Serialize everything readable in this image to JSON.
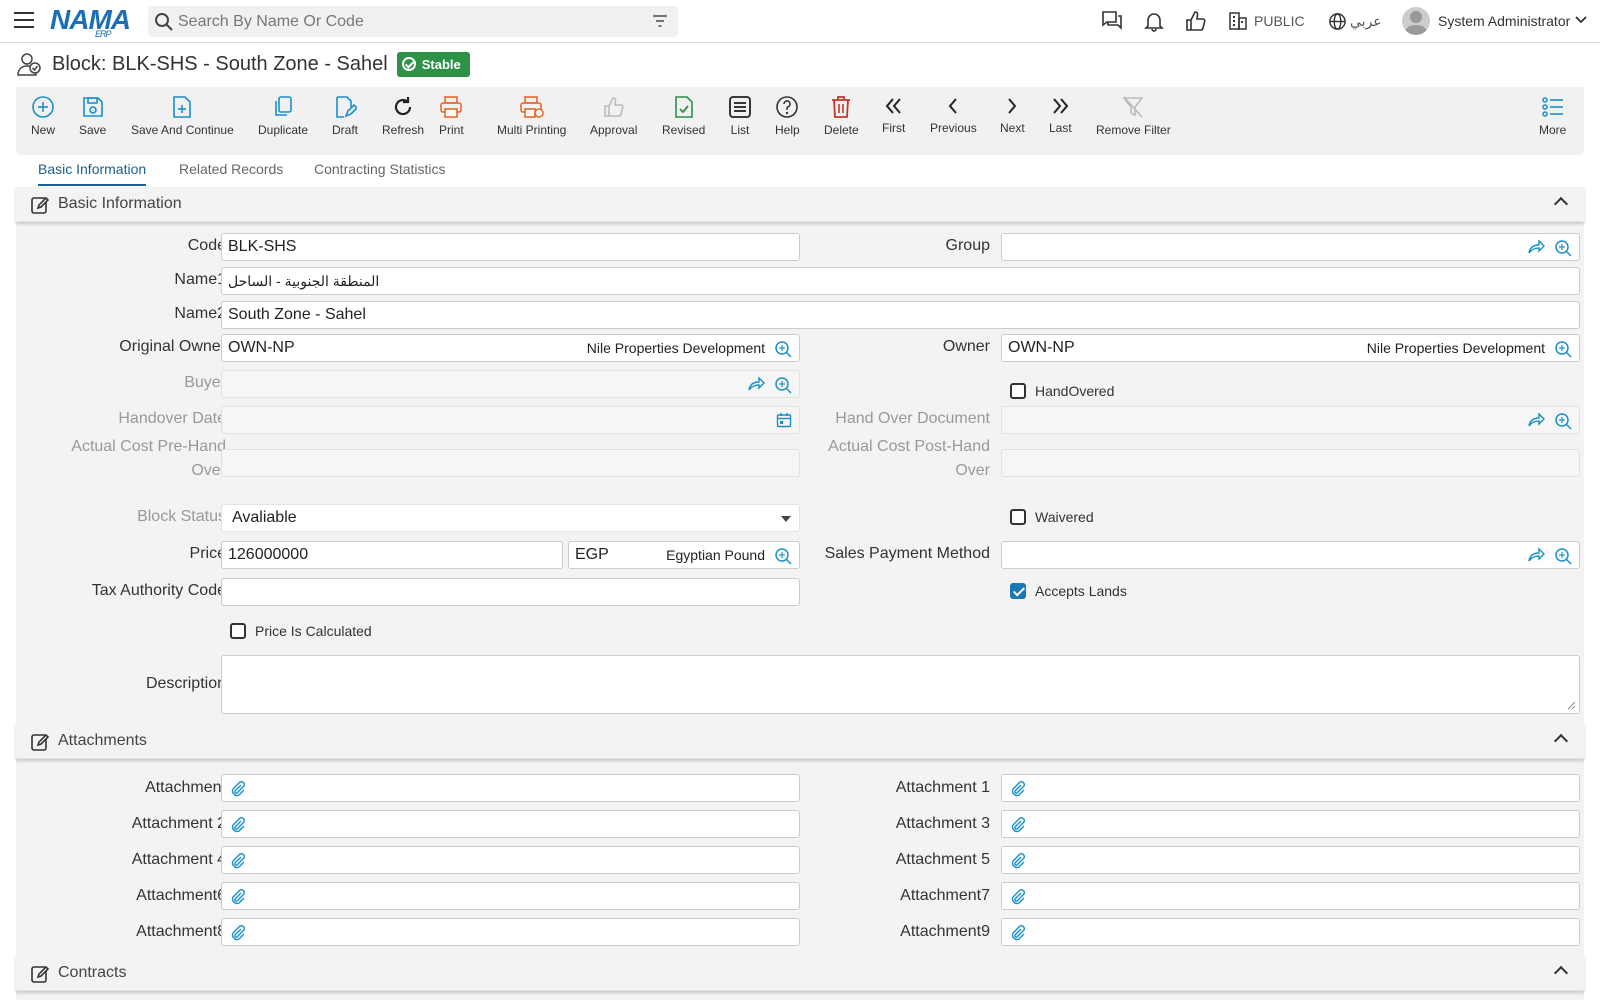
{
  "topbar": {
    "logo": "NAMA",
    "logo_sub": "ERP",
    "search_placeholder": "Search By Name Or Code",
    "branch": "PUBLIC",
    "language": "عربي",
    "user": "System Administrator"
  },
  "title": {
    "text": "Block: BLK-SHS - South Zone - Sahel",
    "status": "Stable"
  },
  "toolbar": {
    "new": "New",
    "save": "Save",
    "save_continue": "Save And Continue",
    "duplicate": "Duplicate",
    "draft": "Draft",
    "refresh": "Refresh",
    "print": "Print",
    "multi_printing": "Multi Printing",
    "approval": "Approval",
    "revised": "Revised",
    "list": "List",
    "help": "Help",
    "delete": "Delete",
    "first": "First",
    "previous": "Previous",
    "next": "Next",
    "last": "Last",
    "remove_filter": "Remove Filter",
    "more": "More"
  },
  "tabs": [
    "Basic Information",
    "Related Records",
    "Contracting Statistics"
  ],
  "sections": {
    "basic": "Basic Information",
    "attachments": "Attachments",
    "contracts": "Contracts"
  },
  "labels": {
    "code": "Code",
    "group": "Group",
    "name1": "Name1",
    "name2": "Name2",
    "original_owner": "Original Owner",
    "owner": "Owner",
    "buyer": "Buyer",
    "handovered": "HandOvered",
    "handover_date": "Handover Date",
    "hand_over_document": "Hand Over Document",
    "actual_cost_pre_1": "Actual Cost Pre-Hand",
    "actual_cost_pre_2": "Over",
    "actual_cost_post_1": "Actual Cost Post-Hand",
    "actual_cost_post_2": "Over",
    "block_status": "Block Status",
    "waivered": "Waivered",
    "price": "Price",
    "sales_payment_method": "Sales Payment Method",
    "tax_authority_code": "Tax Authority Code",
    "accepts_lands": "Accepts Lands",
    "price_is_calculated": "Price Is Calculated",
    "description": "Description"
  },
  "values": {
    "code": "BLK-SHS",
    "name1": "المنطقة الجنوبية - الساحل",
    "name2": "South Zone - Sahel",
    "original_owner_code": "OWN-NP",
    "original_owner_name": "Nile Properties Development",
    "owner_code": "OWN-NP",
    "owner_name": "Nile Properties Development",
    "block_status": "Avaliable",
    "price": "126000000",
    "currency_code": "EGP",
    "currency_name": "Egyptian Pound",
    "handovered": false,
    "waivered": false,
    "accepts_lands": true,
    "price_is_calculated": false
  },
  "attachments": {
    "left": [
      "Attachment",
      "Attachment 2",
      "Attachment 4",
      "Attachment6",
      "Attachment8"
    ],
    "right": [
      "Attachment 1",
      "Attachment 3",
      "Attachment 5",
      "Attachment7",
      "Attachment9"
    ]
  },
  "colors": {
    "accent": "#1b5f8f",
    "stable_badge": "#2e9148",
    "icon_blue": "#1a90c9",
    "print_orange": "#e8682a",
    "delete_red": "#c0392b"
  }
}
